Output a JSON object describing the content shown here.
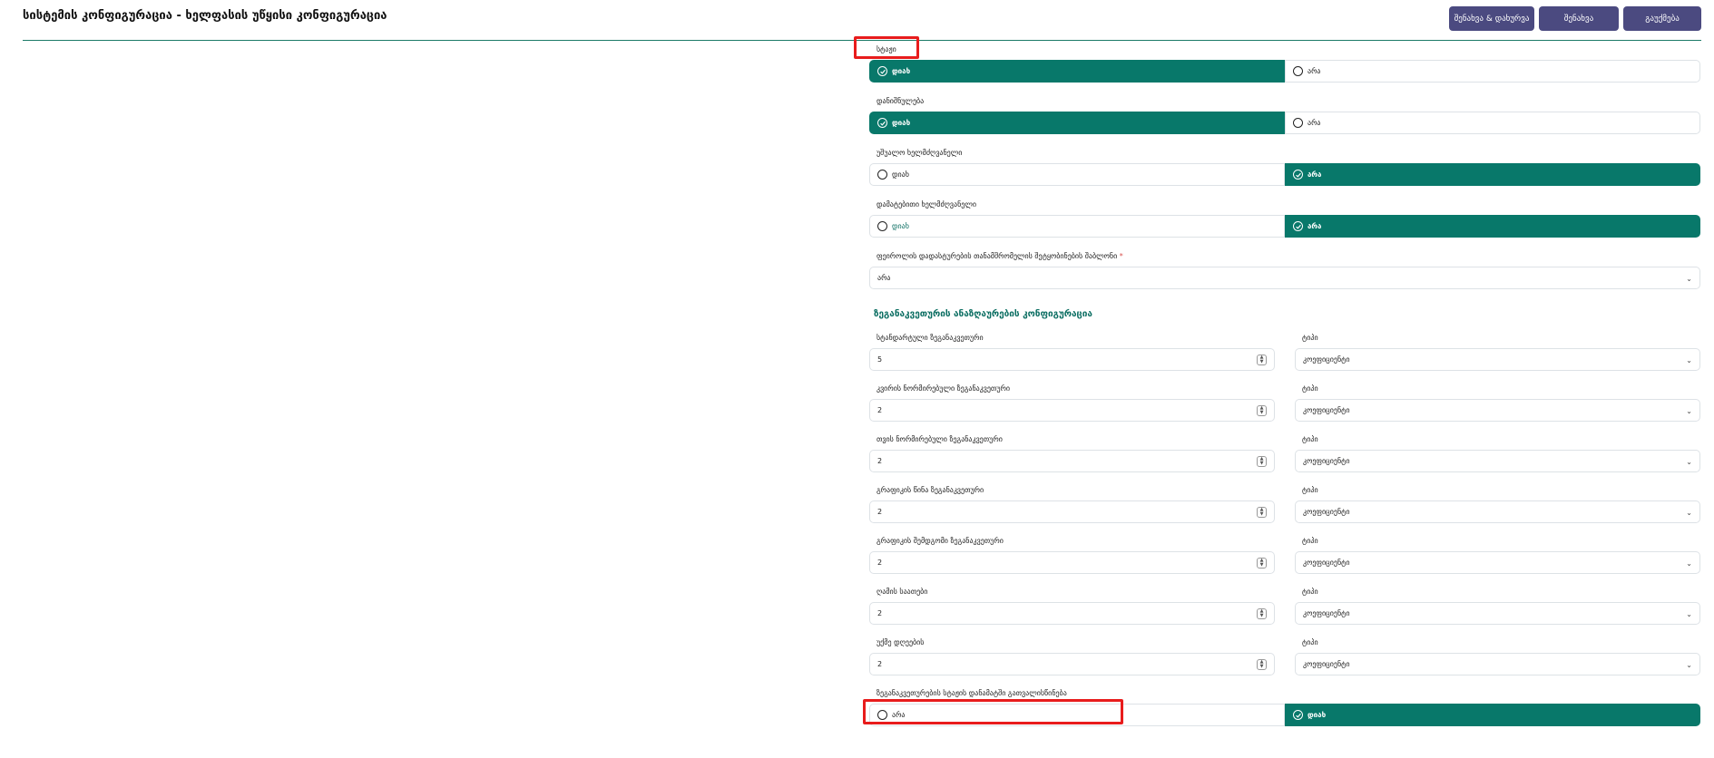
{
  "header": {
    "title": "სისტემის კონფიგურაცია - ხელფასის უწყისი კონფიგურაცია",
    "buttons": [
      "შენახვა & დახურვა",
      "შენახვა",
      "გაუქმება"
    ]
  },
  "radio_groups": [
    {
      "label": "სტაჟი",
      "options": [
        "დიახ",
        "არა"
      ],
      "selected": 0
    },
    {
      "label": "დანიშნულება",
      "options": [
        "დიახ",
        "არა"
      ],
      "selected": 0
    },
    {
      "label": "უშუალო ხელმძღვანელი",
      "options": [
        "დიახ",
        "არა"
      ],
      "selected": 1
    },
    {
      "label": "დამატებითი ხელმძღვანელი",
      "options": [
        "დიახ",
        "არა"
      ],
      "selected": 1
    }
  ],
  "template_select": {
    "label": "ფეიროლის დადასტურების თანამშრომელის შეტყობინების შაბლონი",
    "required_mark": "*",
    "value": "არა"
  },
  "coefficients_section": {
    "title": "ზეგანაკვეთურის ანაზღაურების კონფიგურაცია",
    "type_label": "ტიპი",
    "rows": [
      {
        "label": "სტანდარტული ზეგანაკვეთური",
        "value": "5",
        "type": "კოეფიციენტი"
      },
      {
        "label": "კვირის ნორმირებული ზეგანაკვეთური",
        "value": "2",
        "type": "კოეფიციენტი"
      },
      {
        "label": "თვის ნორმირებული ზეგანაკვეთური",
        "value": "2",
        "type": "კოეფიციენტი"
      },
      {
        "label": "გრაფიკის წინა ზეგანაკვეთური",
        "value": "2",
        "type": "კოეფიციენტი"
      },
      {
        "label": "გრაფიკის შემდგომი ზეგანაკვეთური",
        "value": "2",
        "type": "კოეფიციენტი"
      },
      {
        "label": "ღამის საათები",
        "value": "2",
        "type": "კოეფიციენტი"
      },
      {
        "label": "უქმე დღეების",
        "value": "2",
        "type": "კოეფიციენტი"
      }
    ]
  },
  "final_radio": {
    "label": "ზეგანაკვეთურების სტაჟის დანამატში გათვალისწინება",
    "options": [
      "არა",
      "დიახ"
    ],
    "selected": 1
  },
  "colors": {
    "accent": "#08786a",
    "button": "#4b4a80",
    "highlight": "#e81c1c"
  }
}
